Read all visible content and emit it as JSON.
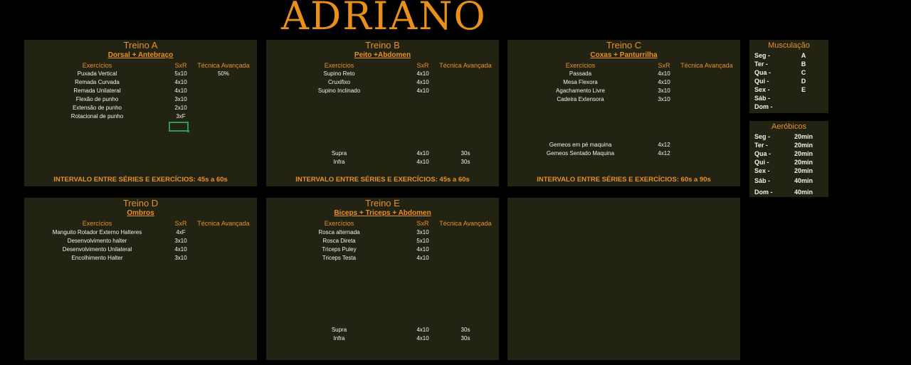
{
  "page_title": "ADRIANO",
  "columns": {
    "exercise": "Exercícios",
    "sets_reps": "SxR",
    "technique": "Técnica Avançada"
  },
  "treino_a": {
    "title": "Treino A",
    "subtitle": "Dorsal + Antebraço",
    "rows": [
      {
        "exercise": "Puxada Vertical",
        "sets_reps": "5x10",
        "technique": "50%"
      },
      {
        "exercise": "Remada Curvada",
        "sets_reps": "4x10",
        "technique": ""
      },
      {
        "exercise": "Remada Unilateral",
        "sets_reps": "4x10",
        "technique": ""
      },
      {
        "exercise": "Flexão de punho",
        "sets_reps": "3x10",
        "technique": ""
      },
      {
        "exercise": "Extensão de punho",
        "sets_reps": "2x10",
        "technique": ""
      },
      {
        "exercise": "Rotacional de punho",
        "sets_reps": "3xF",
        "technique": ""
      }
    ],
    "footer": "INTERVALO ENTRE SÉRIES E EXERCÍCIOS: 45s a 60s"
  },
  "treino_b": {
    "title": "Treino B",
    "subtitle": "Peito +Abdomen",
    "rows": [
      {
        "exercise": "Supino Reto",
        "sets_reps": "4x10",
        "technique": ""
      },
      {
        "exercise": "Cruxifixo",
        "sets_reps": "4x10",
        "technique": ""
      },
      {
        "exercise": "Supino Inclinado",
        "sets_reps": "4x10",
        "technique": ""
      }
    ],
    "extra_rows": [
      {
        "exercise": "Supra",
        "sets_reps": "4x10",
        "technique": "30s"
      },
      {
        "exercise": "Infra",
        "sets_reps": "4x10",
        "technique": "30s"
      }
    ],
    "footer": "INTERVALO ENTRE SÉRIES E EXERCÍCIOS: 45s a 60s"
  },
  "treino_c": {
    "title": "Treino C",
    "subtitle": "Coxas +  Panturrilha",
    "rows": [
      {
        "exercise": "Passada",
        "sets_reps": "4x10",
        "technique": ""
      },
      {
        "exercise": "Mesa Flexora",
        "sets_reps": "4x10",
        "technique": ""
      },
      {
        "exercise": "Agachamento Livre",
        "sets_reps": "3x10",
        "technique": ""
      },
      {
        "exercise": "Cadeira Extensora",
        "sets_reps": "3x10",
        "technique": ""
      }
    ],
    "extra_rows": [
      {
        "exercise": "Gemeos em pé  maquina",
        "sets_reps": "4x12",
        "technique": ""
      },
      {
        "exercise": "Gemeos Sentado Maquina",
        "sets_reps": "4x12",
        "technique": ""
      }
    ],
    "footer": "INTERVALO ENTRE SÉRIES E EXERCÍCIOS: 60s a 90s"
  },
  "treino_d": {
    "title": "Treino D",
    "subtitle": "Ombros",
    "rows": [
      {
        "exercise": "Manguito Rotador Externo Halteres",
        "sets_reps": "4xF",
        "technique": ""
      },
      {
        "exercise": "Desenvolvimento halter",
        "sets_reps": "3x10",
        "technique": ""
      },
      {
        "exercise": "Desenvolvimento Unilateral",
        "sets_reps": "4x10",
        "technique": ""
      },
      {
        "exercise": "Encolhimento Halter",
        "sets_reps": "3x10",
        "technique": ""
      }
    ]
  },
  "treino_e": {
    "title": "Treino E",
    "subtitle": "Biceps + Triceps + Abdomen",
    "rows": [
      {
        "exercise": "Rosca alternada",
        "sets_reps": "3x10",
        "technique": ""
      },
      {
        "exercise": "Rosca Direta",
        "sets_reps": "5x10",
        "technique": ""
      },
      {
        "exercise": "Triceps Puley",
        "sets_reps": "4x10",
        "technique": ""
      },
      {
        "exercise": "Triceps Testa",
        "sets_reps": "4x10",
        "technique": ""
      }
    ],
    "extra_rows": [
      {
        "exercise": "Supra",
        "sets_reps": "4x10",
        "technique": "30s"
      },
      {
        "exercise": "Infra",
        "sets_reps": "4x10",
        "technique": "30s"
      }
    ]
  },
  "musculacao": {
    "title": "Musculação",
    "days": [
      {
        "day": "Seg -",
        "value": "A"
      },
      {
        "day": "Ter -",
        "value": "B"
      },
      {
        "day": "Qua -",
        "value": "C"
      },
      {
        "day": "Qui -",
        "value": "D"
      },
      {
        "day": "Sex -",
        "value": "E"
      },
      {
        "day": "Sáb -",
        "value": ""
      },
      {
        "day": "Dom -",
        "value": ""
      }
    ]
  },
  "aerobicos": {
    "title": "Aeróbicos",
    "days": [
      {
        "day": "Seg -",
        "value": "20min"
      },
      {
        "day": "Ter -",
        "value": "20min"
      },
      {
        "day": "Qua -",
        "value": "20min"
      },
      {
        "day": "Qui -",
        "value": "20min"
      },
      {
        "day": "Sex -",
        "value": "20min"
      },
      {
        "day": "Sáb -",
        "value": "40min"
      },
      {
        "day": "Dom -",
        "value": "40min"
      }
    ]
  }
}
